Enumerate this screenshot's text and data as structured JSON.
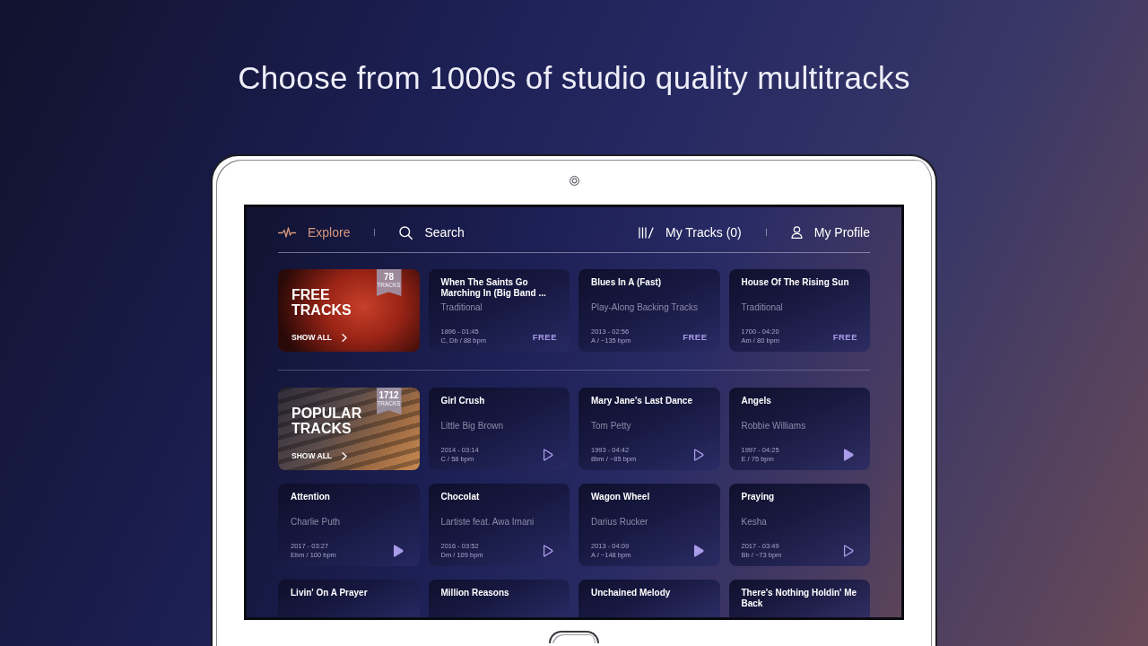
{
  "headline": "Choose from 1000s of studio quality multitracks",
  "nav": {
    "left": [
      {
        "kind": "explore",
        "label": "Explore",
        "selected": true
      },
      {
        "kind": "search",
        "label": "Search",
        "selected": false
      }
    ],
    "right": [
      {
        "kind": "tracks",
        "label": "My Tracks (0)",
        "selected": false
      },
      {
        "kind": "profile",
        "label": "My Profile",
        "selected": false
      }
    ]
  },
  "sections": [
    {
      "category": {
        "kind": "free",
        "title": "FREE TRACKS",
        "count": "78",
        "count_label": "TRACKS",
        "link": "SHOW ALL"
      },
      "tracks": [
        {
          "title": "When The Saints Go Marching In (Big Band ...",
          "artist": "Traditional",
          "date_duration": "1896 - 01:45",
          "key_bpm": "C, Db / 88 bpm",
          "kind": "free",
          "tag": "FREE"
        },
        {
          "title": "Blues In A (Fast)",
          "artist": "Play-Along Backing Tracks",
          "date_duration": "2013 - 02:56",
          "key_bpm": "A / ~135 bpm",
          "kind": "free",
          "tag": "FREE"
        },
        {
          "title": "House Of The Rising Sun",
          "artist": "Traditional",
          "date_duration": "1700 - 04:20",
          "key_bpm": "Am / 80 bpm",
          "kind": "free",
          "tag": "FREE"
        }
      ]
    },
    {
      "category": {
        "kind": "popular",
        "title": "POPULAR TRACKS",
        "count": "1712",
        "count_label": "TRACKS",
        "link": "SHOW ALL"
      },
      "tracks": [
        {
          "title": "Girl Crush",
          "artist": "Little Big Brown",
          "date_duration": "2014 - 03:14",
          "key_bpm": "C / 58 bpm",
          "kind": "play",
          "filled": false
        },
        {
          "title": "Mary Jane's Last Dance",
          "artist": "Tom Petty",
          "date_duration": "1993 - 04:42",
          "key_bpm": "8bm / ~85 bpm",
          "kind": "play",
          "filled": false
        },
        {
          "title": "Angels",
          "artist": "Robbie Williams",
          "date_duration": "1997 - 04:25",
          "key_bpm": "E / 75 bpm",
          "kind": "play",
          "filled": true
        },
        {
          "title": "Attention",
          "artist": "Charlie Puth",
          "date_duration": "2017 - 03:27",
          "key_bpm": "Ebm / 100 bpm",
          "kind": "play",
          "filled": true
        },
        {
          "title": "Chocolat",
          "artist": "Lartiste feat. Awa Imani",
          "date_duration": "2016 - 03:52",
          "key_bpm": "Dm / 109 bpm",
          "kind": "play",
          "filled": false
        },
        {
          "title": "Wagon Wheel",
          "artist": "Darius Rucker",
          "date_duration": "2013 - 04:09",
          "key_bpm": "A / ~148 bpm",
          "kind": "play",
          "filled": true
        },
        {
          "title": "Praying",
          "artist": "Kesha",
          "date_duration": "2017 - 03:49",
          "key_bpm": "Bb / ~73 bpm",
          "kind": "play",
          "filled": false
        },
        {
          "title": "Livin' On A Prayer"
        },
        {
          "title": "Million Reasons"
        },
        {
          "title": "Unchained Melody"
        },
        {
          "title": "There's Nothing Holdin' Me Back"
        }
      ]
    }
  ]
}
